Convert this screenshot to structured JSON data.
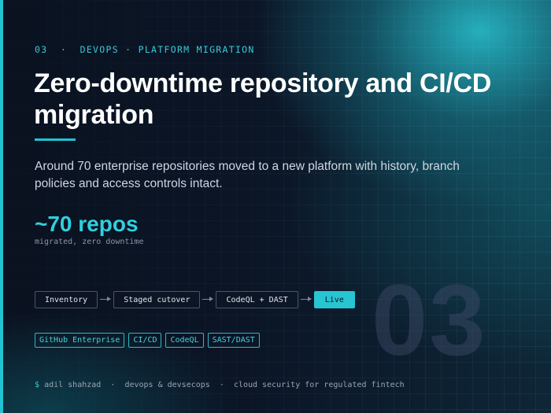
{
  "colors": {
    "accent": "#22c3d1",
    "background": "#0b1221",
    "text": "#ffffff",
    "muted": "#9aa4b4"
  },
  "header": {
    "index": "03",
    "separator": "·",
    "category": "DEVOPS · PLATFORM MIGRATION"
  },
  "title": "Zero-downtime repository and CI/CD migration",
  "description": "Around 70 enterprise repositories moved to a new platform with history, branch policies and access controls intact.",
  "metric": {
    "value": "~70 repos",
    "caption": "migrated, zero downtime"
  },
  "pipeline": {
    "stages": [
      "Inventory",
      "Staged cutover",
      "CodeQL + DAST",
      "Live"
    ]
  },
  "tags": [
    "GitHub Enterprise",
    "CI/CD",
    "CodeQL",
    "SAST/DAST"
  ],
  "background_number": "03",
  "footer": {
    "prompt": "$",
    "name": "adil shahzad",
    "role": "devops & devsecops",
    "focus": "cloud security for regulated fintech",
    "separator": "·"
  }
}
